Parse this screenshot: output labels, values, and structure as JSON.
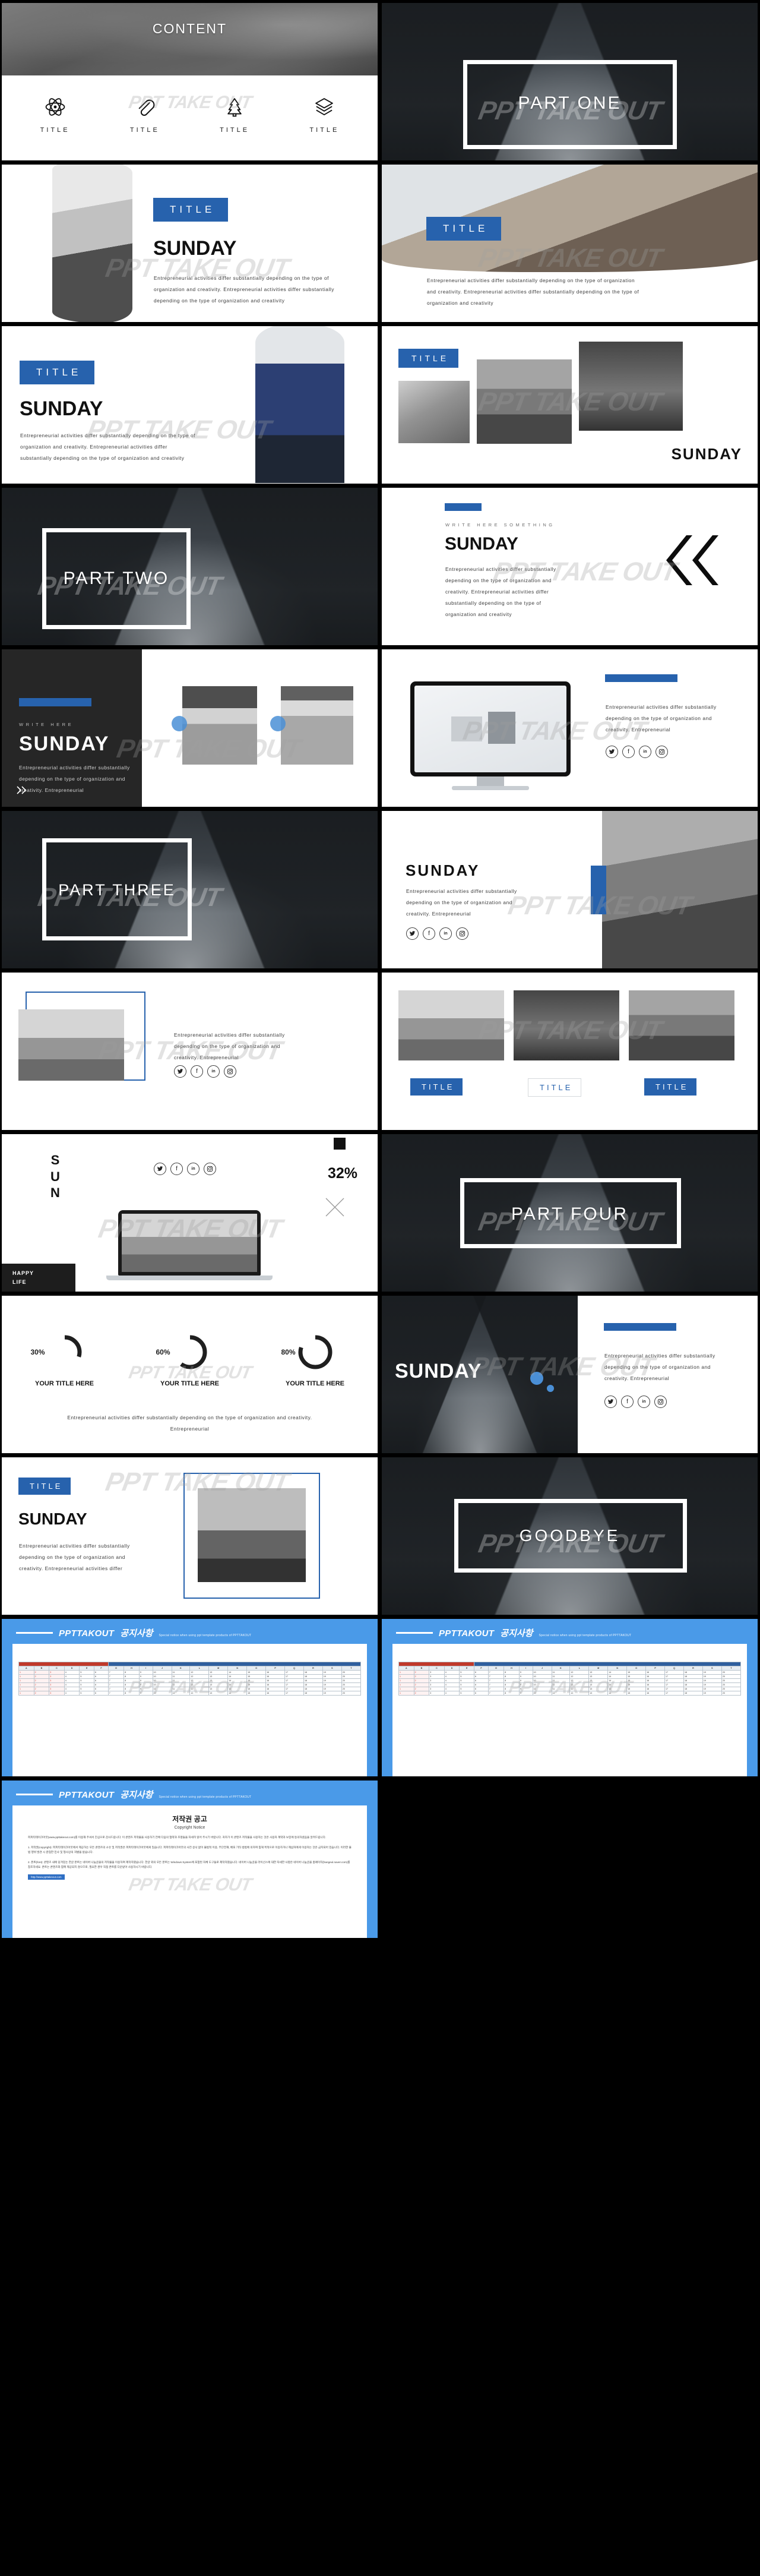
{
  "brand": {
    "watermark": "PPT TAKE OUT",
    "notice_brand": "PPTTAKOUT"
  },
  "colors": {
    "accent_blue": "#2762ad",
    "notice_blue": "#4a9ae8",
    "dark_panel": "#262626",
    "black": "#000000",
    "white": "#ffffff"
  },
  "copy": {
    "body_long": "Entrepreneurial activities differ substantially depending on the type of organization and creativity. Entrepreneurial activities differ substantially depending on the type of organization and creativity",
    "body_mid": "Entrepreneurial activities differ substantially depending on the type of organization and creativity. Entrepreneurial activities differ",
    "body_short": "Entrepreneurial activities differ substantially depending on the type of organization and creativity. Entrepreneurial",
    "body_narrow": "Entrepreneurial activities differ substantially depending on the type of organization and creativity. Entrepreneurial",
    "body_center": "Entrepreneurial activities differ substantially depending on the type of organization and creativity. Entrepreneurial"
  },
  "slides": [
    {
      "id": "content",
      "title": "CONTENT",
      "icons": [
        {
          "name": "atom-icon",
          "label": "TITLE"
        },
        {
          "name": "paperclip-icon",
          "label": "TITLE"
        },
        {
          "name": "tree-icon",
          "label": "TITLE"
        },
        {
          "name": "layers-icon",
          "label": "TITLE"
        }
      ]
    },
    {
      "id": "part-one",
      "title": "PART ONE"
    },
    {
      "id": "title-sunday-left",
      "badge": "TITLE",
      "heading": "SUNDAY"
    },
    {
      "id": "title-sunday-photo",
      "badge": "TITLE"
    },
    {
      "id": "title-sunday-man",
      "badge": "TITLE",
      "heading": "SUNDAY"
    },
    {
      "id": "title-gallery",
      "badge": "TITLE",
      "heading": "SUNDAY"
    },
    {
      "id": "part-two",
      "title": "PART TWO"
    },
    {
      "id": "write-here-something",
      "kicker": "WRITE HERE SOMETHING",
      "heading": "SUNDAY"
    },
    {
      "id": "dark-sunday",
      "kicker": "WRITE HERE",
      "heading": "SUNDAY"
    },
    {
      "id": "monitor-mock"
    },
    {
      "id": "part-three",
      "title": "PART THREE"
    },
    {
      "id": "sunday-social",
      "heading": "SUNDAY"
    },
    {
      "id": "mountain-frame"
    },
    {
      "id": "three-photo-titles",
      "buttons": [
        {
          "label": "TITLE",
          "style": "solid"
        },
        {
          "label": "TITLE",
          "style": "hollow"
        },
        {
          "label": "TITLE",
          "style": "solid"
        }
      ]
    },
    {
      "id": "sun-laptop",
      "vertical_word": [
        "S",
        "U",
        "N"
      ],
      "percent": "32%",
      "footer_line1": "HAPPY",
      "footer_line2": "LIFE"
    },
    {
      "id": "part-four",
      "title": "PART FOUR"
    },
    {
      "id": "donut-stats",
      "donuts": [
        {
          "value": 30,
          "label": "30%",
          "title": "YOUR TITLE HERE"
        },
        {
          "value": 60,
          "label": "60%",
          "title": "YOUR TITLE HERE"
        },
        {
          "value": 80,
          "label": "80%",
          "title": "YOUR TITLE HERE"
        }
      ]
    },
    {
      "id": "sunday-dark-split",
      "heading": "SUNDAY"
    },
    {
      "id": "title-eiffel",
      "badge": "TITLE",
      "heading": "SUNDAY"
    },
    {
      "id": "goodbye",
      "title": "GOODBYE"
    },
    {
      "id": "notice-1",
      "brand": "PPTTAKOUT",
      "korean": "공지사항",
      "subtitle": "Special notice when using ppt template products of PPTTAKOUT"
    },
    {
      "id": "notice-2",
      "brand": "PPTTAKOUT",
      "korean": "공지사항",
      "subtitle": "Special notice when using ppt template products of PPTTAKOUT"
    },
    {
      "id": "copyright",
      "brand": "PPTTAKOUT",
      "korean": "공지사항",
      "subtitle": "Special notice when using ppt template products of PPTTAKOUT",
      "doc_title_kr": "저작권 공고",
      "doc_title_en": "Copyright Notice",
      "paragraphs": [
        "피피티테이크아웃(www.ppttakeout.com)를 이용해 주셔서 진심으로 감사드립니다. 이 콘텐츠 저작물을 사용하기 전에 다음의 협약과 조항들을 자세히 읽어 주시기 바랍니다. 귀하가 이 콘텐츠 저작물을 사용하는 것은 사용자 계약과 보증에 동의하셨음을 알려드립니다.",
        "1. 저작권(copyright): 피피티테이크아웃에서 제공하는 모든 콘텐츠의 소유 및 저작권은 피피티테이크아웃에게 있습니다. 피피티테이크아웃의 사전 승낙 없이 불법적 이용, 무단전재, 배포 기타 방법에 의하여 침해 목적으로 이용하거나 제삼자에게 이용하는 것은 금지되어 있습니다. 이러한 불법 행위 발견 시 준엄한 민사 및 형사상의 처벌을 받습니다.",
        "2. 폰트(font): 콘텐츠 내에 담겨있는 한글 폰트는 네이버 나눔글꼴의 저작물을 이용하여 제작하였습니다. 한글 외의 모든 폰트는 Windows System에 포함된 자체 도구들로 제작하였습니다. 네이버 나눔글꼴 라이선스에 대한 자세한 사항은 네이버 나눔글꼴 홈페이지(hangeul.naver.com)를 참조하세요. 폰트는 콘텐츠와 함께 제공되지 않으므로, 필요한 경우 직접 폰트를 다운받아 사용하시기 바랍니다."
      ],
      "link_label": "http://www.ppttakeout.com"
    },
    {
      "id": "black-end"
    }
  ]
}
